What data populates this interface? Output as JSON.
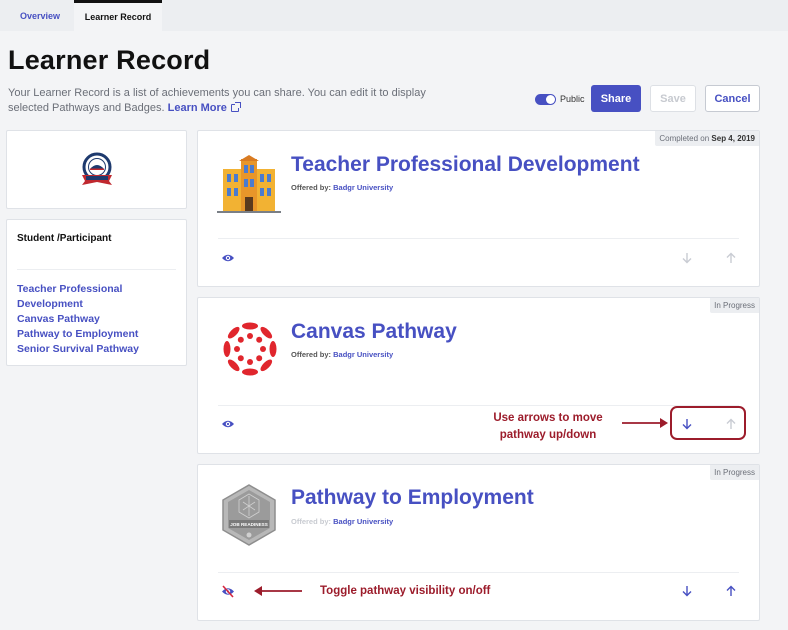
{
  "tabs": [
    {
      "label": "Overview",
      "active": false
    },
    {
      "label": "Learner Record",
      "active": true
    }
  ],
  "header": {
    "title": "Learner Record",
    "description": "Your Learner Record is a list of achievements you can share. You can edit it to display selected Pathways and Badges.",
    "learn_more": "Learn More"
  },
  "controls": {
    "public_label": "Public",
    "public_on": true,
    "share_label": "Share",
    "save_label": "Save",
    "cancel_label": "Cancel"
  },
  "sidebar": {
    "title": "Student /Participant",
    "links": [
      "Teacher Professional Development",
      "Canvas Pathway",
      "Pathway to Employment",
      "Senior Survival Pathway"
    ]
  },
  "pathways": [
    {
      "title": "Teacher Professional Development",
      "offered_by_label": "Offered by:",
      "org": "Badgr University",
      "status_prefix": "Completed on",
      "status_date": "Sep 4, 2019",
      "visible": true,
      "icon": "school-building-icon"
    },
    {
      "title": "Canvas Pathway",
      "offered_by_label": "Offered by:",
      "org": "Badgr University",
      "status": "In Progress",
      "visible": true,
      "icon": "canvas-logo-icon"
    },
    {
      "title": "Pathway to Employment",
      "offered_by_label": "Offered by:",
      "org": "Badgr University",
      "status": "In Progress",
      "visible": false,
      "icon": "job-readiness-badge-icon",
      "badge_text": "JOB READINESS"
    }
  ],
  "annotations": {
    "arrows_line1": "Use arrows to move",
    "arrows_line2": "pathway up/down",
    "toggle": "Toggle pathway visibility on/off"
  },
  "colors": {
    "accent": "#4750c2",
    "annotation": "#9c1c2b",
    "canvas_red": "#e0262d"
  }
}
